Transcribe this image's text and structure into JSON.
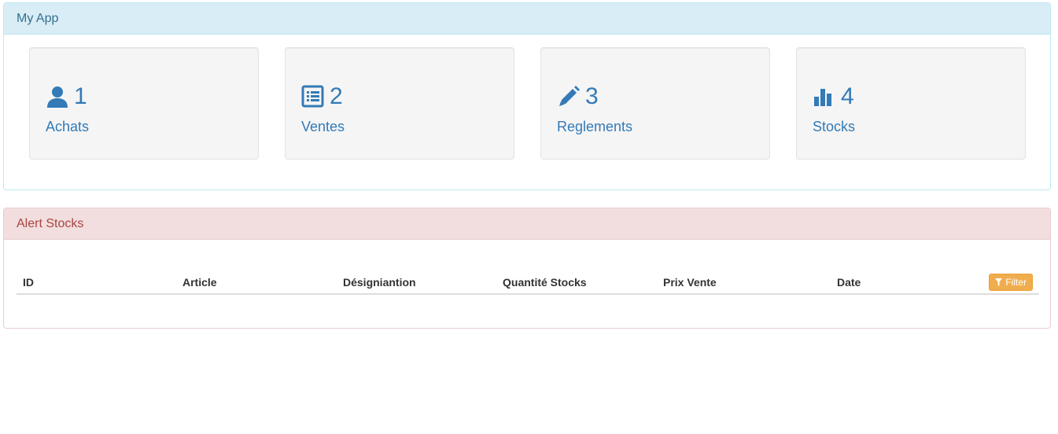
{
  "app": {
    "title": "My App"
  },
  "tiles": [
    {
      "number": "1",
      "label": "Achats",
      "icon": "user-icon"
    },
    {
      "number": "2",
      "label": "Ventes",
      "icon": "list-alt-icon"
    },
    {
      "number": "3",
      "label": "Reglements",
      "icon": "pencil-icon"
    },
    {
      "number": "4",
      "label": "Stocks",
      "icon": "bar-chart-icon"
    }
  ],
  "alert": {
    "title": "Alert Stocks",
    "columns": [
      "ID",
      "Article",
      "Désigniantion",
      "Quantité Stocks",
      "Prix Vente",
      "Date"
    ],
    "filter_label": "Filter",
    "filter_icon": "filter-icon"
  },
  "colors": {
    "link": "#337ab7",
    "info_heading_bg": "#d9edf7",
    "danger_heading_bg": "#f2dede",
    "danger_text": "#a94442",
    "warning_button": "#f0ad4e"
  }
}
